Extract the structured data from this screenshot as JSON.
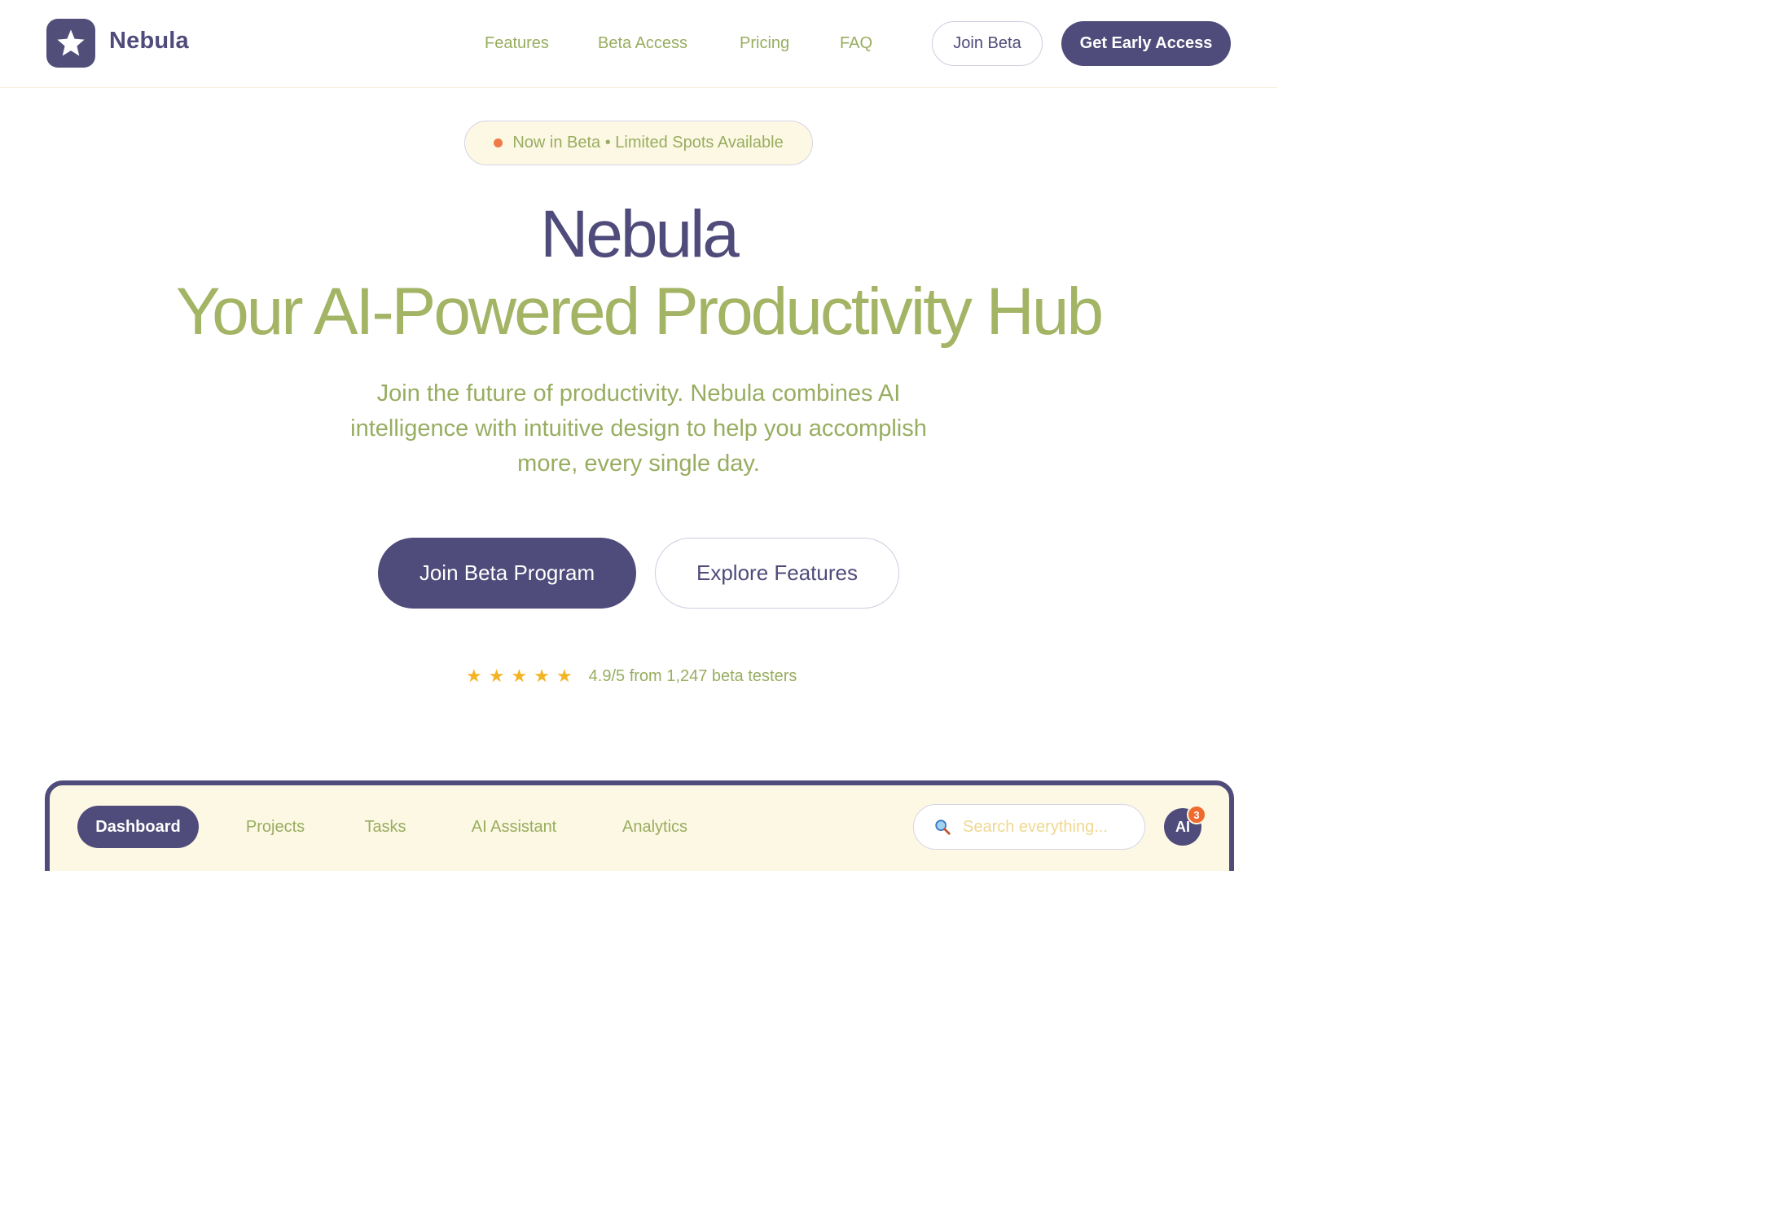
{
  "brand": {
    "name": "Nebula",
    "logo_icon": "star-icon"
  },
  "nav": {
    "links": [
      "Features",
      "Beta Access",
      "Pricing",
      "FAQ"
    ],
    "join_beta": "Join Beta",
    "get_early_access": "Get Early Access"
  },
  "hero": {
    "badge": "Now in Beta • Limited Spots Available",
    "title": "Nebula",
    "subtitle": "Your AI-Powered Productivity Hub",
    "description": "Join the future of productivity. Nebula combines AI intelligence with intuitive design to help you accomplish more, every single day.",
    "primary_cta": "Join Beta Program",
    "secondary_cta": "Explore Features",
    "rating": {
      "stars": 5,
      "text": "4.9/5 from 1,247 beta testers"
    }
  },
  "preview": {
    "tabs": [
      "Dashboard",
      "Projects",
      "Tasks",
      "AI Assistant",
      "Analytics"
    ],
    "active_tab": "Dashboard",
    "search_placeholder": "Search everything...",
    "search_icon": "search-icon",
    "ai_label": "AI",
    "notification_count": "3"
  },
  "colors": {
    "primary": "#4f4b7a",
    "accent_green": "#a3b465",
    "text_green": "#98ad60",
    "cream": "#fdf8e3",
    "star": "#f2b424",
    "status_dot": "#ef7a4a",
    "notification": "#ef6a2e"
  }
}
